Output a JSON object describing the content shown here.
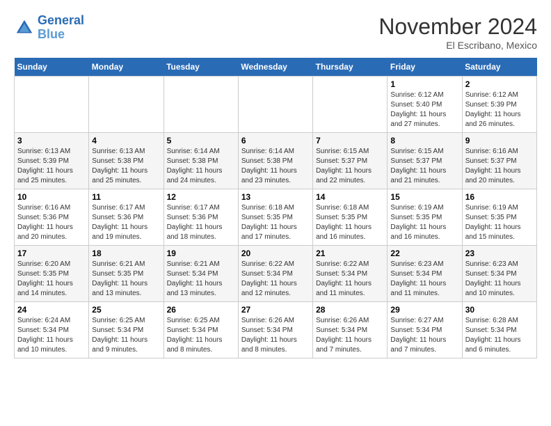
{
  "header": {
    "logo_line1": "General",
    "logo_line2": "Blue",
    "month": "November 2024",
    "location": "El Escribano, Mexico"
  },
  "weekdays": [
    "Sunday",
    "Monday",
    "Tuesday",
    "Wednesday",
    "Thursday",
    "Friday",
    "Saturday"
  ],
  "weeks": [
    [
      {
        "day": "",
        "info": ""
      },
      {
        "day": "",
        "info": ""
      },
      {
        "day": "",
        "info": ""
      },
      {
        "day": "",
        "info": ""
      },
      {
        "day": "",
        "info": ""
      },
      {
        "day": "1",
        "info": "Sunrise: 6:12 AM\nSunset: 5:40 PM\nDaylight: 11 hours and 27 minutes."
      },
      {
        "day": "2",
        "info": "Sunrise: 6:12 AM\nSunset: 5:39 PM\nDaylight: 11 hours and 26 minutes."
      }
    ],
    [
      {
        "day": "3",
        "info": "Sunrise: 6:13 AM\nSunset: 5:39 PM\nDaylight: 11 hours and 25 minutes."
      },
      {
        "day": "4",
        "info": "Sunrise: 6:13 AM\nSunset: 5:38 PM\nDaylight: 11 hours and 25 minutes."
      },
      {
        "day": "5",
        "info": "Sunrise: 6:14 AM\nSunset: 5:38 PM\nDaylight: 11 hours and 24 minutes."
      },
      {
        "day": "6",
        "info": "Sunrise: 6:14 AM\nSunset: 5:38 PM\nDaylight: 11 hours and 23 minutes."
      },
      {
        "day": "7",
        "info": "Sunrise: 6:15 AM\nSunset: 5:37 PM\nDaylight: 11 hours and 22 minutes."
      },
      {
        "day": "8",
        "info": "Sunrise: 6:15 AM\nSunset: 5:37 PM\nDaylight: 11 hours and 21 minutes."
      },
      {
        "day": "9",
        "info": "Sunrise: 6:16 AM\nSunset: 5:37 PM\nDaylight: 11 hours and 20 minutes."
      }
    ],
    [
      {
        "day": "10",
        "info": "Sunrise: 6:16 AM\nSunset: 5:36 PM\nDaylight: 11 hours and 20 minutes."
      },
      {
        "day": "11",
        "info": "Sunrise: 6:17 AM\nSunset: 5:36 PM\nDaylight: 11 hours and 19 minutes."
      },
      {
        "day": "12",
        "info": "Sunrise: 6:17 AM\nSunset: 5:36 PM\nDaylight: 11 hours and 18 minutes."
      },
      {
        "day": "13",
        "info": "Sunrise: 6:18 AM\nSunset: 5:35 PM\nDaylight: 11 hours and 17 minutes."
      },
      {
        "day": "14",
        "info": "Sunrise: 6:18 AM\nSunset: 5:35 PM\nDaylight: 11 hours and 16 minutes."
      },
      {
        "day": "15",
        "info": "Sunrise: 6:19 AM\nSunset: 5:35 PM\nDaylight: 11 hours and 16 minutes."
      },
      {
        "day": "16",
        "info": "Sunrise: 6:19 AM\nSunset: 5:35 PM\nDaylight: 11 hours and 15 minutes."
      }
    ],
    [
      {
        "day": "17",
        "info": "Sunrise: 6:20 AM\nSunset: 5:35 PM\nDaylight: 11 hours and 14 minutes."
      },
      {
        "day": "18",
        "info": "Sunrise: 6:21 AM\nSunset: 5:35 PM\nDaylight: 11 hours and 13 minutes."
      },
      {
        "day": "19",
        "info": "Sunrise: 6:21 AM\nSunset: 5:34 PM\nDaylight: 11 hours and 13 minutes."
      },
      {
        "day": "20",
        "info": "Sunrise: 6:22 AM\nSunset: 5:34 PM\nDaylight: 11 hours and 12 minutes."
      },
      {
        "day": "21",
        "info": "Sunrise: 6:22 AM\nSunset: 5:34 PM\nDaylight: 11 hours and 11 minutes."
      },
      {
        "day": "22",
        "info": "Sunrise: 6:23 AM\nSunset: 5:34 PM\nDaylight: 11 hours and 11 minutes."
      },
      {
        "day": "23",
        "info": "Sunrise: 6:23 AM\nSunset: 5:34 PM\nDaylight: 11 hours and 10 minutes."
      }
    ],
    [
      {
        "day": "24",
        "info": "Sunrise: 6:24 AM\nSunset: 5:34 PM\nDaylight: 11 hours and 10 minutes."
      },
      {
        "day": "25",
        "info": "Sunrise: 6:25 AM\nSunset: 5:34 PM\nDaylight: 11 hours and 9 minutes."
      },
      {
        "day": "26",
        "info": "Sunrise: 6:25 AM\nSunset: 5:34 PM\nDaylight: 11 hours and 8 minutes."
      },
      {
        "day": "27",
        "info": "Sunrise: 6:26 AM\nSunset: 5:34 PM\nDaylight: 11 hours and 8 minutes."
      },
      {
        "day": "28",
        "info": "Sunrise: 6:26 AM\nSunset: 5:34 PM\nDaylight: 11 hours and 7 minutes."
      },
      {
        "day": "29",
        "info": "Sunrise: 6:27 AM\nSunset: 5:34 PM\nDaylight: 11 hours and 7 minutes."
      },
      {
        "day": "30",
        "info": "Sunrise: 6:28 AM\nSunset: 5:34 PM\nDaylight: 11 hours and 6 minutes."
      }
    ]
  ]
}
